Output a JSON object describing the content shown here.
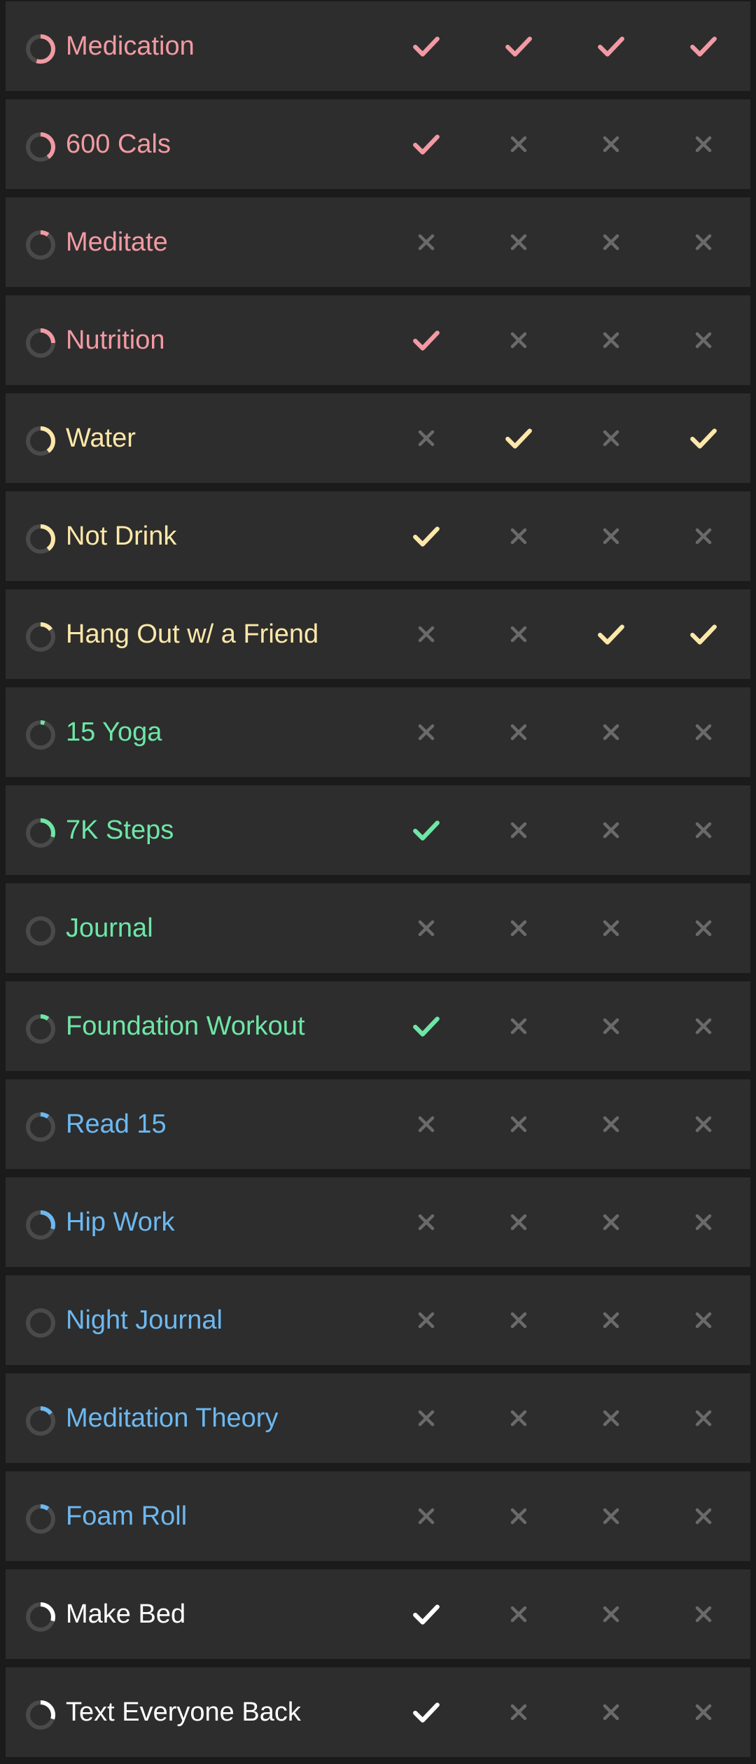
{
  "colors": {
    "red": "#f29aa3",
    "yellow": "#fde8a9",
    "green": "#6ee6a6",
    "blue": "#6db8f0",
    "white": "#ffffff",
    "cross": "#6a6a6a",
    "ring_track": "#4a4a4a",
    "row_background": "#2d2d2d",
    "page_background": "#1b1b1b"
  },
  "habits": [
    {
      "name": "Medication",
      "color": "red",
      "progress": 0.55,
      "days": [
        true,
        true,
        true,
        true
      ]
    },
    {
      "name": "600 Cals",
      "color": "red",
      "progress": 0.4,
      "days": [
        true,
        false,
        false,
        false
      ]
    },
    {
      "name": "Meditate",
      "color": "red",
      "progress": 0.1,
      "days": [
        false,
        false,
        false,
        false
      ]
    },
    {
      "name": "Nutrition",
      "color": "red",
      "progress": 0.25,
      "days": [
        true,
        false,
        false,
        false
      ]
    },
    {
      "name": "Water",
      "color": "yellow",
      "progress": 0.4,
      "days": [
        false,
        true,
        false,
        true
      ]
    },
    {
      "name": "Not Drink",
      "color": "yellow",
      "progress": 0.4,
      "days": [
        true,
        false,
        false,
        false
      ]
    },
    {
      "name": "Hang Out w/ a Friend",
      "color": "yellow",
      "progress": 0.15,
      "days": [
        false,
        false,
        true,
        true
      ]
    },
    {
      "name": "15 Yoga",
      "color": "green",
      "progress": 0.05,
      "days": [
        false,
        false,
        false,
        false
      ]
    },
    {
      "name": "7K Steps",
      "color": "green",
      "progress": 0.3,
      "days": [
        true,
        false,
        false,
        false
      ]
    },
    {
      "name": "Journal",
      "color": "green",
      "progress": 0,
      "days": [
        false,
        false,
        false,
        false
      ]
    },
    {
      "name": "Foundation Workout",
      "color": "green",
      "progress": 0.1,
      "days": [
        true,
        false,
        false,
        false
      ]
    },
    {
      "name": "Read 15",
      "color": "blue",
      "progress": 0.1,
      "days": [
        false,
        false,
        false,
        false
      ]
    },
    {
      "name": "Hip Work",
      "color": "blue",
      "progress": 0.3,
      "days": [
        false,
        false,
        false,
        false
      ]
    },
    {
      "name": "Night Journal",
      "color": "blue",
      "progress": 0,
      "days": [
        false,
        false,
        false,
        false
      ]
    },
    {
      "name": "Meditation Theory",
      "color": "blue",
      "progress": 0.15,
      "days": [
        false,
        false,
        false,
        false
      ]
    },
    {
      "name": "Foam Roll",
      "color": "blue",
      "progress": 0.1,
      "days": [
        false,
        false,
        false,
        false
      ]
    },
    {
      "name": "Make Bed",
      "color": "white",
      "progress": 0.3,
      "days": [
        true,
        false,
        false,
        false
      ]
    },
    {
      "name": "Text Everyone Back",
      "color": "white",
      "progress": 0.3,
      "days": [
        true,
        false,
        false,
        false
      ]
    }
  ]
}
